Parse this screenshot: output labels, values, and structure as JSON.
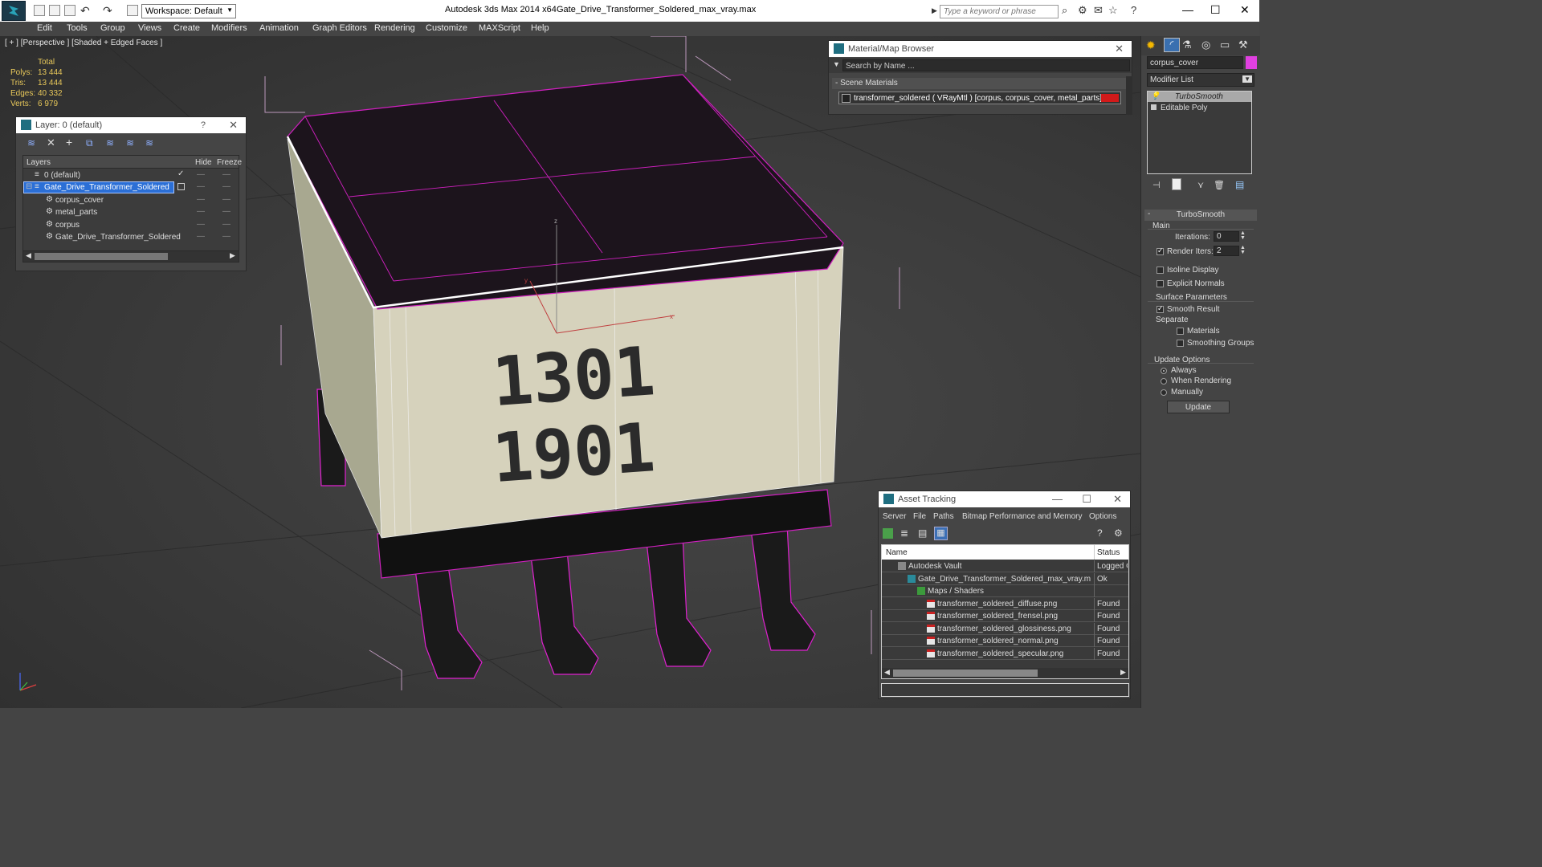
{
  "titlebar": {
    "app_title": "Autodesk 3ds Max  2014 x64",
    "file_title": "Gate_Drive_Transformer_Soldered_max_vray.max",
    "workspace_label": "Workspace: Default",
    "search_placeholder": "Type a keyword or phrase"
  },
  "menu": {
    "items": [
      "Edit",
      "Tools",
      "Group",
      "Views",
      "Create",
      "Modifiers",
      "Animation",
      "Graph Editors",
      "Rendering",
      "Customize",
      "MAXScript",
      "Help"
    ]
  },
  "viewport": {
    "label": "[ + ] [Perspective ] [Shaded + Edged Faces ]",
    "stats": {
      "header": "Total",
      "rows": [
        {
          "key": "Polys:",
          "value": "13 444"
        },
        {
          "key": "Tris:",
          "value": "13 444"
        },
        {
          "key": "Edges:",
          "value": "40 332"
        },
        {
          "key": "Verts:",
          "value": "6 979"
        }
      ]
    },
    "axis_z": "z",
    "axis_x": "x",
    "axis_y": "y"
  },
  "layer_panel": {
    "title": "Layer: 0 (default)",
    "help": "?",
    "col_layers": "Layers",
    "col_hide": "Hide",
    "col_freeze": "Freeze",
    "rows": [
      {
        "name": "0 (default)",
        "indent": 0
      },
      {
        "name": "Gate_Drive_Transformer_Soldered",
        "indent": 0,
        "selected": true
      },
      {
        "name": "corpus_cover",
        "indent": 1
      },
      {
        "name": "metal_parts",
        "indent": 1
      },
      {
        "name": "corpus",
        "indent": 1
      },
      {
        "name": "Gate_Drive_Transformer_Soldered",
        "indent": 1
      }
    ]
  },
  "material_browser": {
    "title": "Material/Map Browser",
    "search_placeholder": "Search by Name ...",
    "section": "- Scene Materials",
    "material": "transformer_soldered  ( VRayMtl ) [corpus, corpus_cover, metal_parts]"
  },
  "asset_tracking": {
    "title": "Asset Tracking",
    "menu": [
      "Server",
      "File",
      "Paths",
      "Bitmap Performance and Memory",
      "Options"
    ],
    "col_name": "Name",
    "col_status": "Status",
    "rows": [
      {
        "name": "Autodesk Vault",
        "status": "Logged O",
        "indent": 1
      },
      {
        "name": "Gate_Drive_Transformer_Soldered_max_vray.max",
        "status": "Ok",
        "indent": 2
      },
      {
        "name": "Maps / Shaders",
        "status": "",
        "indent": 3
      },
      {
        "name": "transformer_soldered_diffuse.png",
        "status": "Found",
        "indent": 4
      },
      {
        "name": "transformer_soldered_frensel.png",
        "status": "Found",
        "indent": 4
      },
      {
        "name": "transformer_soldered_glossiness.png",
        "status": "Found",
        "indent": 4
      },
      {
        "name": "transformer_soldered_normal.png",
        "status": "Found",
        "indent": 4
      },
      {
        "name": "transformer_soldered_specular.png",
        "status": "Found",
        "indent": 4
      }
    ]
  },
  "command_panel": {
    "object_name": "corpus_cover",
    "object_color": "#e040e0",
    "modifier_list": "Modifier List",
    "stack": [
      "TurboSmooth",
      "Editable Poly"
    ],
    "rollout_title": "TurboSmooth",
    "main_label": "Main",
    "iterations_label": "Iterations:",
    "iterations_value": "0",
    "render_iters_label": "Render Iters:",
    "render_iters_value": "2",
    "isoline": "Isoline Display",
    "explicit_normals": "Explicit Normals",
    "surface_params": "Surface Parameters",
    "smooth_result": "Smooth Result",
    "separate": "Separate",
    "materials": "Materials",
    "smoothing_groups": "Smoothing Groups",
    "update_options": "Update Options",
    "always": "Always",
    "when_rendering": "When Rendering",
    "manually": "Manually",
    "update_button": "Update"
  },
  "texture_text": {
    "line1": "1301",
    "line2": "1901"
  }
}
